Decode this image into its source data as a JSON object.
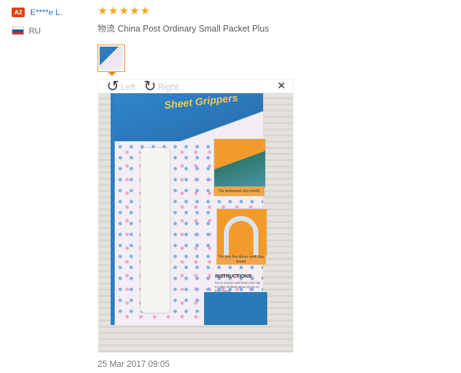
{
  "reviewer": {
    "level_badge": "A2",
    "name": "E****e L.",
    "country": "RU",
    "flag_colors": [
      "#ffffff",
      "#1c57a7",
      "#d52b1e"
    ]
  },
  "review": {
    "rating": 5,
    "stars": [
      "★",
      "★",
      "★",
      "★",
      "★"
    ],
    "shipping_label": "物流",
    "shipping_method": "China Post Ordinary Small Packet Plus",
    "timestamp": "25 Mar 2017 09:05"
  },
  "viewer": {
    "rotate_left_label": "Left",
    "rotate_right_label": "Right",
    "close_symbol": "✕",
    "rotate_left_icon": "↺",
    "rotate_right_icon": "↻"
  },
  "product_image": {
    "brand_text": "Sheet Grippers",
    "caption_1": "The bedspread clips fixedly",
    "caption_2": "The very fine dinner cloth clips fixedly",
    "instructions_heading": "INSTRUCTIONS",
    "instructions_text": "Put in corners and fasten the clip to edge of sheet about 10-15 cm from corner"
  },
  "colors": {
    "accent_orange": "#f08a24",
    "link_blue": "#1a6fc9",
    "star_color": "#f5a623",
    "badge_red": "#e0420c"
  }
}
